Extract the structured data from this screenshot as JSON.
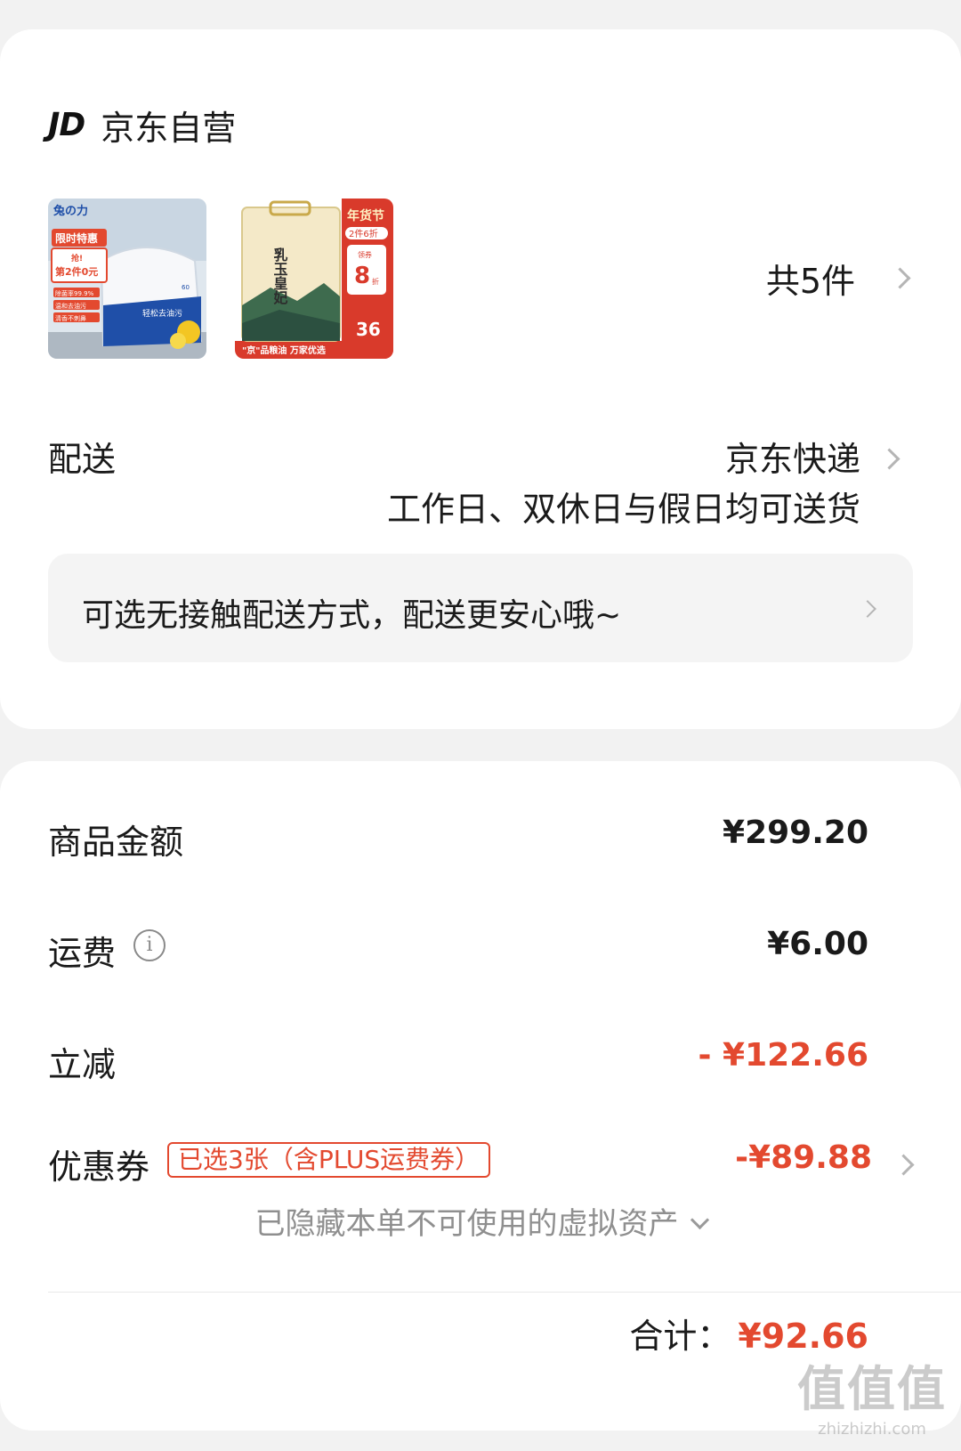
{
  "shop": {
    "logo": "JD",
    "name": "京东自营",
    "item_count": "共5件",
    "products": [
      {
        "name": "wet-wipes",
        "brand": "兔の力",
        "promo": "限时特惠",
        "promo_detail_1": "抢!",
        "promo_detail_2": "第2件0元",
        "tag_1": "除菌率99.9%",
        "tag_2": "温和去油污",
        "tag_3": "清香不刺鼻",
        "slogan": "轻松去油污",
        "count": "60"
      },
      {
        "name": "rice",
        "title": "乳玉皇妃",
        "festival": "年货节",
        "deal": "2件6折",
        "coupon": "领券",
        "discount": "8",
        "discount_unit": "折",
        "price": "36",
        "banner": "\"京\"品粮油 万家优选"
      }
    ]
  },
  "delivery": {
    "label": "配送",
    "method": "京东快递",
    "schedule": "工作日、双休日与假日均可送货",
    "contactless": "可选无接触配送方式，配送更安心哦~"
  },
  "summary": {
    "goods_label": "商品金额",
    "goods_value": "¥299.20",
    "shipping_label": "运费",
    "shipping_value": "¥6.00",
    "discount_label": "立减",
    "discount_value": "- ¥122.66",
    "coupon_label": "优惠券",
    "coupon_badge": "已选3张（含PLUS运费券）",
    "coupon_value": "-¥89.88",
    "hidden_assets": "已隐藏本单不可使用的虚拟资产",
    "total_label": "合计：",
    "total_value": "¥92.66"
  },
  "watermark": {
    "logo": "值值值",
    "site": "zhizhizhi.com"
  },
  "colors": {
    "accent": "#e3492f",
    "background": "#f2f2f2",
    "card": "#ffffff"
  }
}
